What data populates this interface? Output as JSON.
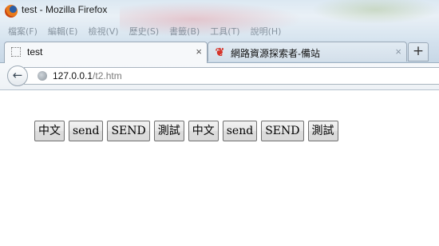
{
  "window": {
    "title": "test - Mozilla Firefox"
  },
  "menubar": [
    "檔案(F)",
    "編輯(E)",
    "檢視(V)",
    "歷史(S)",
    "書籤(B)",
    "工具(T)",
    "說明(H)"
  ],
  "tabs": [
    {
      "label": "test",
      "close": "×",
      "favicon": "blank-page-icon"
    },
    {
      "label": "網路資源探索者-備站",
      "close": "×",
      "favicon": "red-site-icon"
    }
  ],
  "newtab": {
    "label": "+"
  },
  "nav": {
    "back": "←",
    "url_host": "127.0.0.1",
    "url_path": "/t2.htm"
  },
  "page_buttons": [
    "中文",
    "send",
    "SEND",
    "測試",
    "中文",
    "send",
    "SEND",
    "測試"
  ]
}
